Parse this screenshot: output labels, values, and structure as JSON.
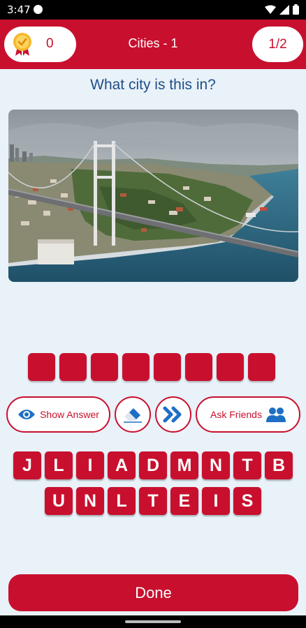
{
  "status_bar": {
    "time": "3:47"
  },
  "header": {
    "score": "0",
    "title": "Cities - 1",
    "progress": "1/2"
  },
  "question": "What city is this in?",
  "answer_slots": 8,
  "actions": {
    "show_answer": "Show Answer",
    "ask_friends": "Ask Friends"
  },
  "letters": {
    "row1": [
      "J",
      "L",
      "I",
      "A",
      "D",
      "M",
      "N",
      "T",
      "B"
    ],
    "row2": [
      "U",
      "N",
      "L",
      "T",
      "E",
      "I",
      "S"
    ]
  },
  "done_label": "Done",
  "colors": {
    "primary": "#c8102e",
    "background": "#e9f1f9",
    "question_text": "#1f4f86",
    "icon_blue": "#1e6fc4"
  }
}
